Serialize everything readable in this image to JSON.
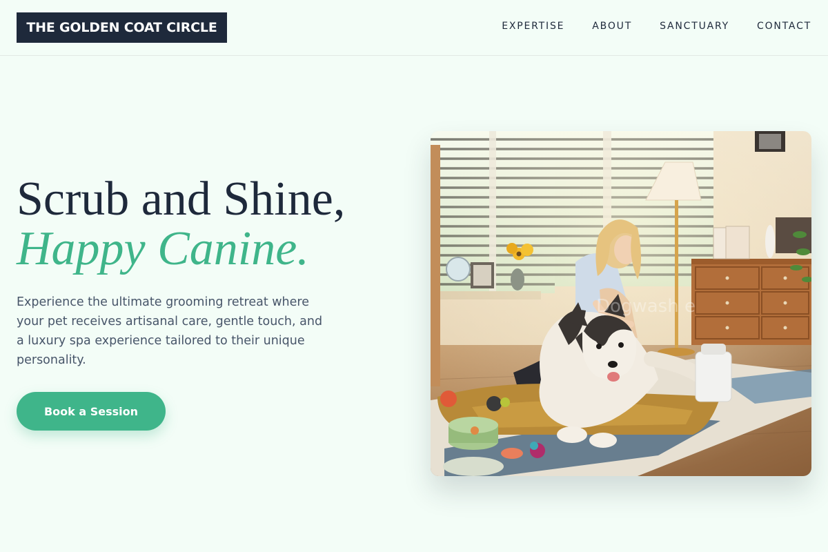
{
  "header": {
    "logo": "THE GOLDEN COAT CIRCLE",
    "nav": [
      "EXPERTISE",
      "ABOUT",
      "SANCTUARY",
      "CONTACT"
    ]
  },
  "hero": {
    "title_line1": "Scrub and Shine,",
    "title_line2": "Happy Canine.",
    "description": "Experience the ultimate grooming retreat where your pet receives artisanal care, gentle touch, and a luxury spa experience tailored to their unique personality.",
    "cta_label": "Book a Session",
    "image_watermark": "Dogwash e"
  },
  "colors": {
    "background": "#f3fdf7",
    "navy": "#1e293b",
    "accent": "#3fb58a",
    "body_text": "#475569"
  }
}
